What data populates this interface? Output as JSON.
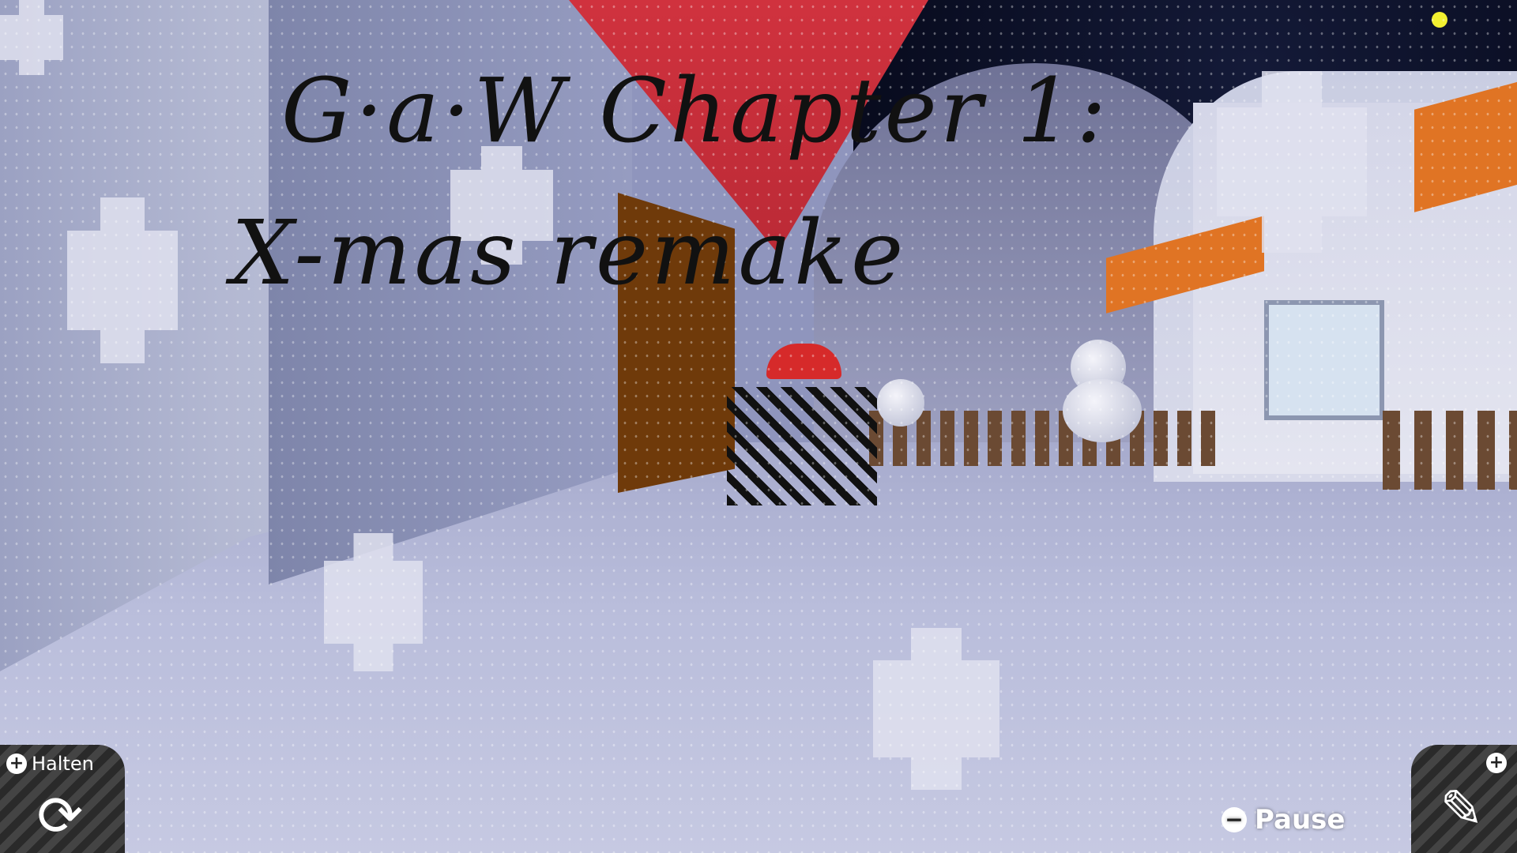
{
  "game": {
    "title_line1": "G·a·W Chapter 1:",
    "title_line2": "X-mas remake"
  },
  "hud": {
    "hold_label": "Halten",
    "hold_icon": "plus-icon",
    "rotate_icon": "rotate-icon",
    "pause_label": "Pause",
    "pause_icon": "minus-icon",
    "edit_icon": "pencil-icon",
    "edit_plus_icon": "plus-icon"
  },
  "colors": {
    "roof": "#d0323e",
    "door": "#6f3a0a",
    "banner": "#e07424",
    "hud_bg": "#333333"
  }
}
